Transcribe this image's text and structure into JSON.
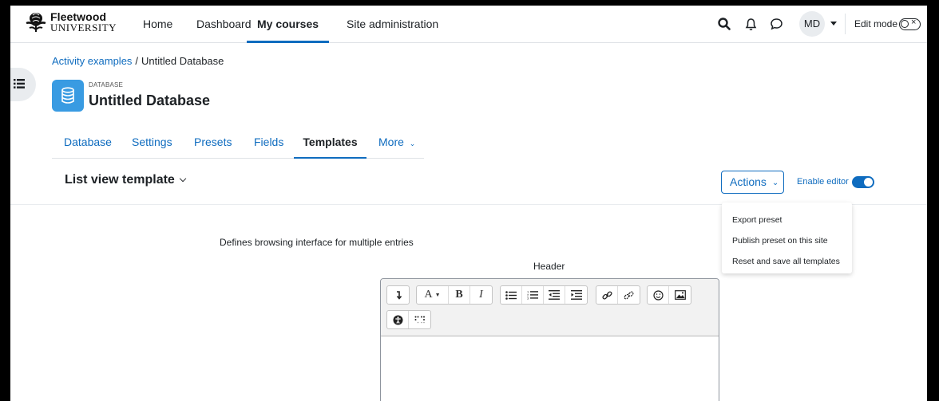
{
  "brand": {
    "line1": "Fleetwood",
    "line2": "UNIVERSITY"
  },
  "nav": {
    "items": [
      {
        "label": "Home",
        "active": false
      },
      {
        "label": "Dashboard",
        "active": false
      },
      {
        "label": "My courses",
        "active": true
      },
      {
        "label": "Site administration",
        "active": false
      }
    ],
    "avatar_initials": "MD",
    "edit_mode_label": "Edit mode",
    "edit_mode_toggle_mark": "×"
  },
  "breadcrumb": {
    "parent": "Activity examples",
    "separator": "/",
    "current": "Untitled Database"
  },
  "header": {
    "module_label": "DATABASE",
    "title": "Untitled Database"
  },
  "tabs": [
    {
      "label": "Database",
      "active": false
    },
    {
      "label": "Settings",
      "active": false
    },
    {
      "label": "Presets",
      "active": false
    },
    {
      "label": "Fields",
      "active": false
    },
    {
      "label": "Templates",
      "active": true
    },
    {
      "label": "More",
      "active": false
    }
  ],
  "template_selector": {
    "label": "List view template"
  },
  "actions": {
    "label": "Actions",
    "menu": [
      "Export preset",
      "Publish preset on this site",
      "Reset and save all templates"
    ]
  },
  "enable_editor": {
    "label": "Enable editor",
    "on": true
  },
  "body": {
    "description": "Defines browsing interface for multiple entries",
    "section_label": "Header"
  },
  "editor_toolbar": {
    "row1": [
      [
        "collapse-icon"
      ],
      [
        "font-style-icon",
        "bold-icon",
        "italic-icon"
      ],
      [
        "unordered-list-icon",
        "ordered-list-icon",
        "outdent-icon",
        "indent-icon"
      ],
      [
        "link-icon",
        "unlink-icon"
      ],
      [
        "emoji-icon",
        "image-icon"
      ]
    ],
    "row2": [
      [
        "accessibility-checker-icon",
        "screenreader-helper-icon"
      ]
    ],
    "glyphs": {
      "bold": "B",
      "italic": "I",
      "font": "A"
    }
  },
  "colors": {
    "primary": "#0f6cbf",
    "db_icon_bg": "#399be2",
    "toolbar_bg": "#f2f2f2"
  }
}
